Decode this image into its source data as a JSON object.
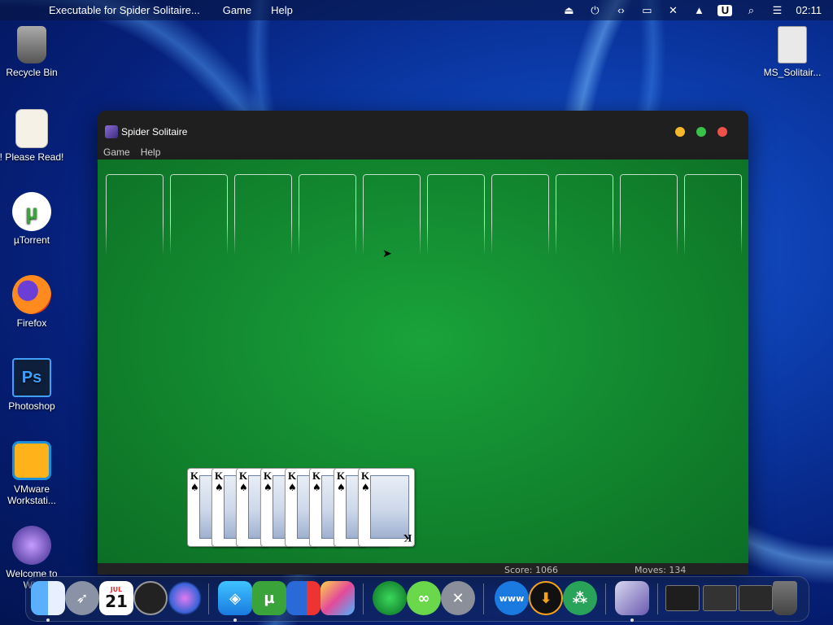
{
  "menubar": {
    "app_name": "Executable for Spider Solitaire...",
    "items": [
      "Game",
      "Help"
    ],
    "time": "02:11"
  },
  "desktop_icons": [
    {
      "label": "Recycle Bin",
      "icon": "trash-icon"
    },
    {
      "label": "! Please Read!",
      "icon": "notepad-icon"
    },
    {
      "label": "µTorrent",
      "icon": "utorrent-icon"
    },
    {
      "label": "Firefox",
      "icon": "firefox-icon"
    },
    {
      "label": "Photoshop",
      "icon": "photoshop-icon"
    },
    {
      "label": "VMware Workstati...",
      "icon": "vmware-icon"
    },
    {
      "label": "Welcome to Win",
      "icon": "apple-icon"
    },
    {
      "label": "MS_Solitair...",
      "icon": "file-icon"
    }
  ],
  "window": {
    "title": "Spider Solitaire",
    "menu": [
      "Game",
      "Help"
    ],
    "score_label": "Score: 1066",
    "moves_label": "Moves: 134",
    "traffic_lights": {
      "minimize": "#f5b82a",
      "zoom": "#39c14a",
      "close": "#f0504a"
    }
  },
  "game": {
    "foundation_slots": 10,
    "completed_cards": [
      {
        "rank": "K",
        "suit": "♠"
      },
      {
        "rank": "K",
        "suit": "♠"
      },
      {
        "rank": "K",
        "suit": "♠"
      },
      {
        "rank": "K",
        "suit": "♠"
      },
      {
        "rank": "K",
        "suit": "♠"
      },
      {
        "rank": "K",
        "suit": "♠"
      },
      {
        "rank": "K",
        "suit": "♠"
      },
      {
        "rank": "K",
        "suit": "♠"
      }
    ]
  },
  "dock": {
    "calendar_month": "JUL",
    "calendar_day": "21",
    "items": [
      "finder-icon",
      "launchpad-icon",
      "calendar-icon",
      "clock-icon",
      "siri-icon",
      "safari-icon",
      "utorrent-icon",
      "parallels-icon",
      "preview-icon",
      "collabsysos-icon",
      "link-icon",
      "tools-icon",
      "www-icon",
      "download-icon",
      "dots-icon",
      "card-game-icon",
      "terminal-thumb-icon",
      "window-thumb-icon",
      "window-thumb2-icon",
      "trash-icon"
    ]
  }
}
